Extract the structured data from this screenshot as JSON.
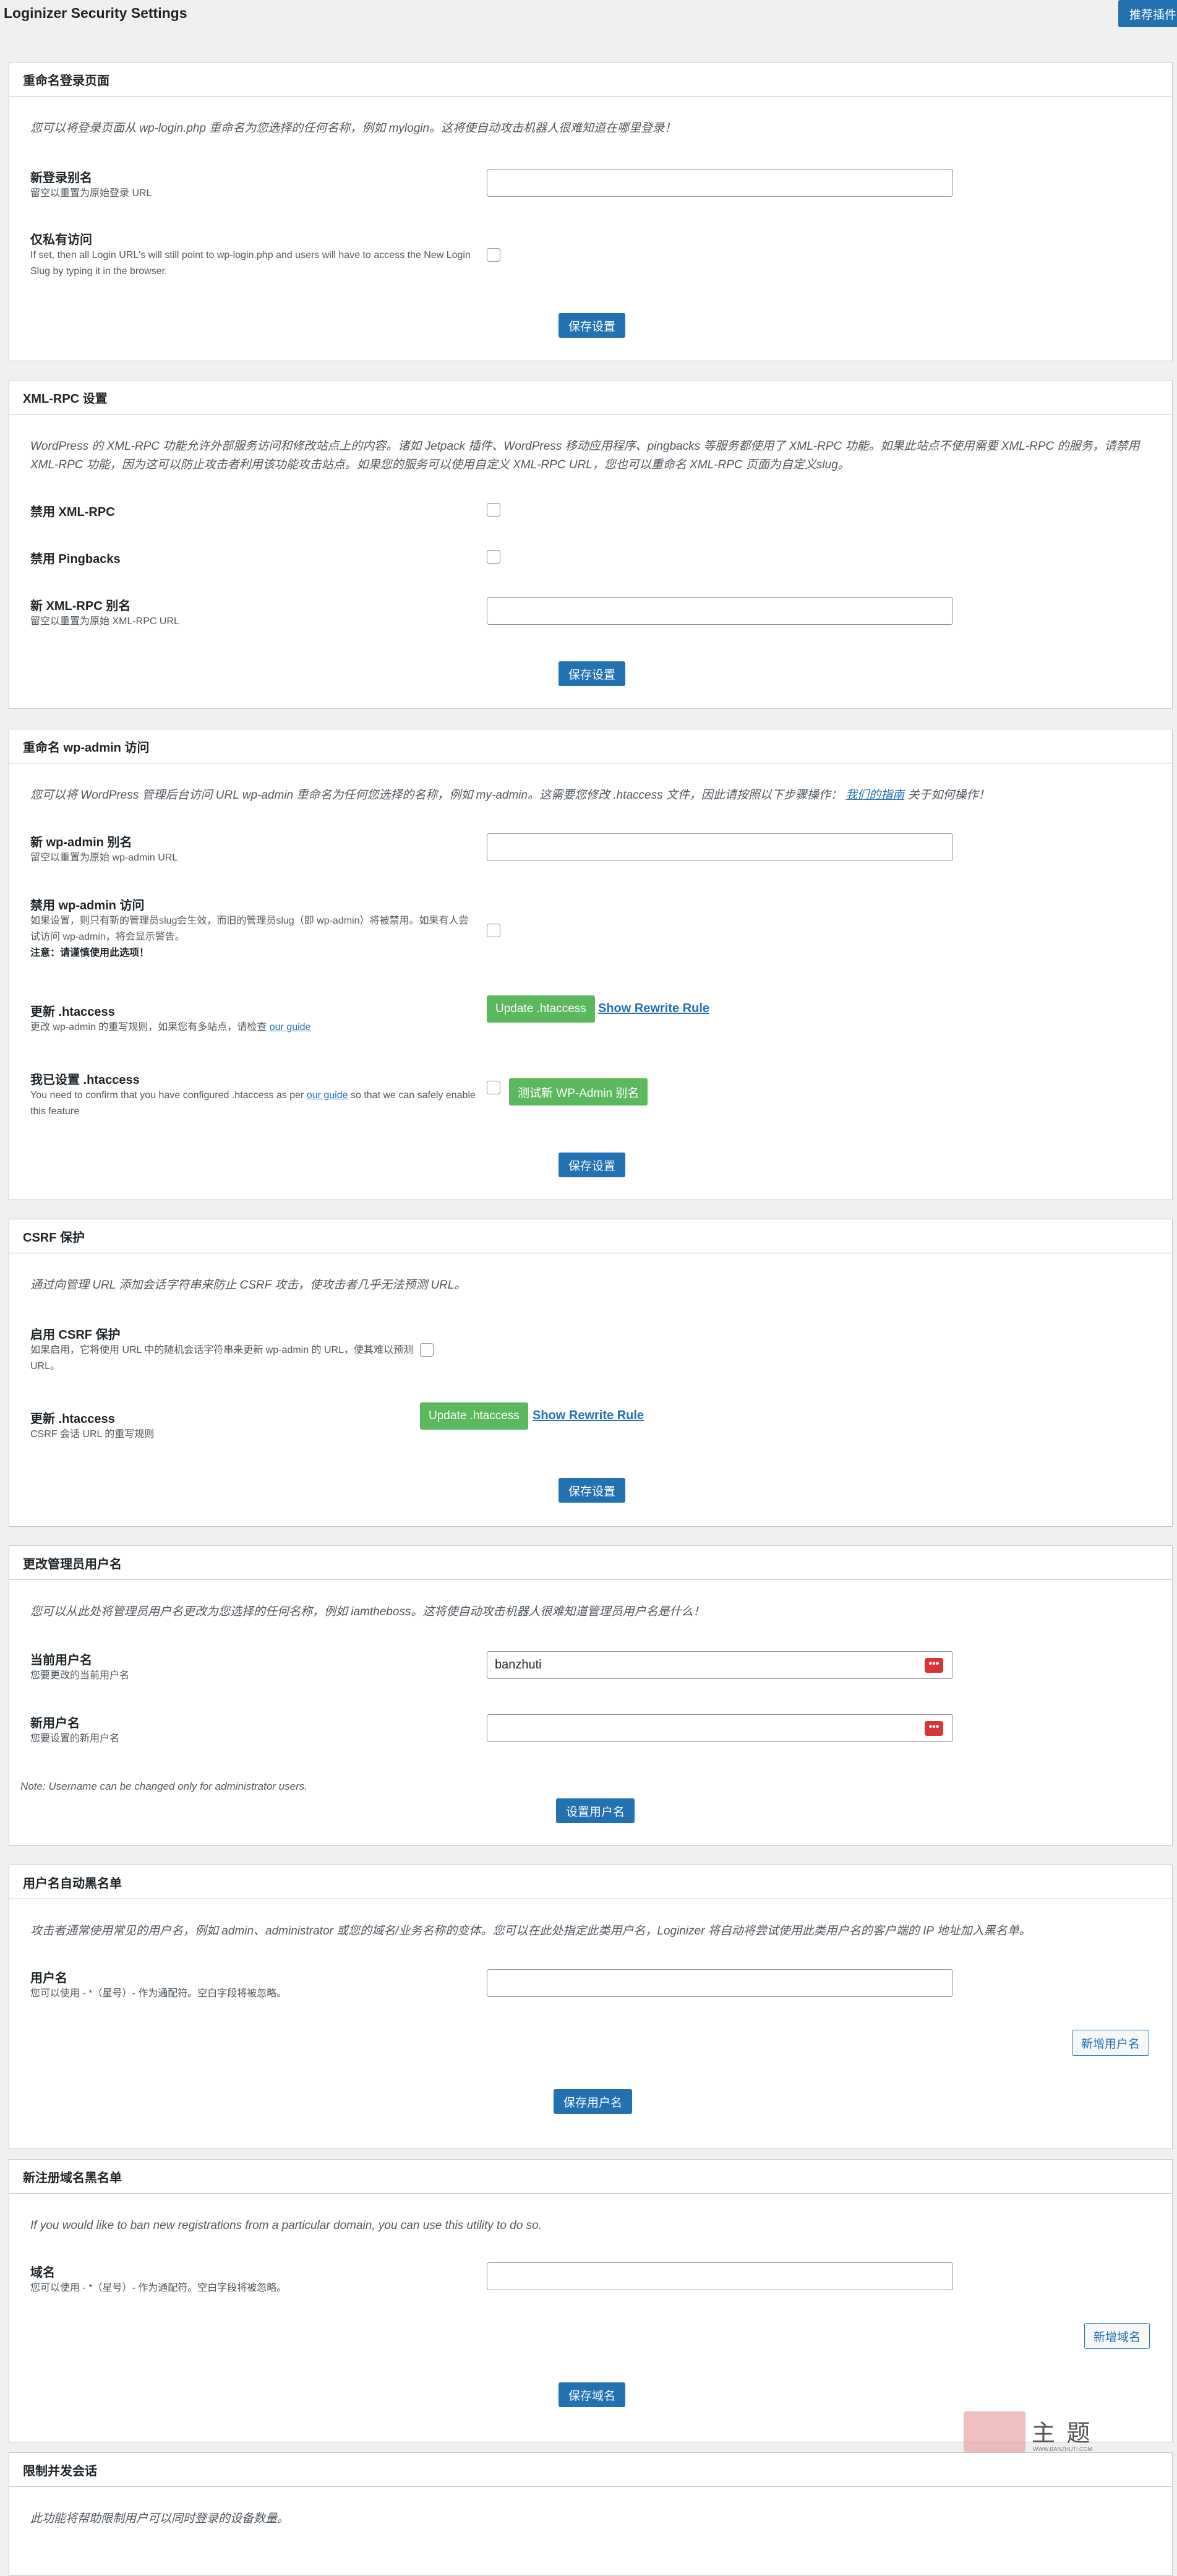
{
  "page": {
    "title": "Loginizer Security Settings",
    "top_button": "推荐",
    "top_button_full": "推荐插件"
  },
  "rename_login": {
    "title": "重命名登录页面",
    "desc": "您可以将登录页面从 wp-login.php 重命名为您选择的任何名称，例如 mylogin。这将使自动攻击机器人很难知道在哪里登录！",
    "slug_label": "新登录别名",
    "slug_sub": "留空以重置为原始登录 URL",
    "slug_value": "",
    "private_label": "仅私有访问",
    "private_sub": "If set, then all Login URL's will still point to wp-login.php and users will have to access the New Login Slug by typing it in the browser.",
    "save": "保存设置"
  },
  "xmlrpc": {
    "title": "XML-RPC 设置",
    "desc": "WordPress 的 XML-RPC 功能允许外部服务访问和修改站点上的内容。诸如 Jetpack 插件、WordPress 移动应用程序、pingbacks 等服务都使用了 XML-RPC 功能。如果此站点不使用需要 XML-RPC 的服务，请禁用 XML-RPC 功能，因为这可以防止攻击者利用该功能攻击站点。如果您的服务可以使用自定义 XML-RPC URL，您也可以重命名 XML-RPC 页面为自定义slug。",
    "disable_label": "禁用 XML-RPC",
    "pingbacks_label": "禁用 Pingbacks",
    "slug_label": "新 XML-RPC 别名",
    "slug_sub": "留空以重置为原始 XML-RPC URL",
    "slug_value": "",
    "save": "保存设置"
  },
  "wpadmin": {
    "title": "重命名 wp-admin 访问",
    "desc_pre": "您可以将 WordPress 管理后台访问 URL wp-admin 重命名为任何您选择的名称，例如 my-admin。这需要您修改 .htaccess 文件，因此请按照以下步骤操作：",
    "desc_link": "我们的指南",
    "desc_post": "关于如何操作！",
    "slug_label": "新 wp-admin 别名",
    "slug_sub": "留空以重置为原始 wp-admin URL",
    "slug_value": "",
    "disable_label": "禁用 wp-admin 访问",
    "disable_sub": "如果设置，则只有新的管理员slug会生效，而旧的管理员slug（即 wp-admin）将被禁用。如果有人尝试访问 wp-admin，将会显示警告。",
    "disable_note": "注意：请谨慎使用此选项！",
    "update_label": "更新 .htaccess",
    "update_sub_pre": "更改 wp-admin 的重写规则，如果您有多站点，请检查",
    "update_sub_link": "our guide",
    "update_btn": "Update .htaccess",
    "rewrite_link": "Show Rewrite Rule",
    "configured_label": "我已设置 .htaccess",
    "configured_sub_pre": "You need to confirm that you have configured .htaccess as per",
    "configured_sub_link": "our guide",
    "configured_sub_post": "so that we can safely enable this feature",
    "test_btn": "测试新 WP-Admin 别名",
    "save": "保存设置"
  },
  "csrf": {
    "title": "CSRF 保护",
    "desc": "通过向管理 URL 添加会话字符串来防止 CSRF 攻击，使攻击者几乎无法预测 URL。",
    "enable_label": "启用 CSRF 保护",
    "enable_sub": "如果启用，它将使用 URL 中的随机会话字符串来更新 wp-admin 的 URL，使其难以预测 URL。",
    "update_label": "更新 .htaccess",
    "update_sub": "CSRF 会话 URL 的重写规则",
    "update_btn": "Update .htaccess",
    "rewrite_link": "Show Rewrite Rule",
    "save": "保存设置"
  },
  "admin_username": {
    "title": "更改管理员用户名",
    "desc": "您可以从此处将管理员用户名更改为您选择的任何名称，例如 iamtheboss。这将使自动攻击机器人很难知道管理员用户名是什么！",
    "current_label": "当前用户名",
    "current_sub": "您要更改的当前用户名",
    "current_value": "banzhuti",
    "new_label": "新用户名",
    "new_sub": "您要设置的新用户名",
    "new_value": "",
    "badge": "•••",
    "note": "Note: Username can be changed only for administrator users.",
    "save": "设置用户名"
  },
  "username_blacklist": {
    "title": "用户名自动黑名单",
    "desc": "攻击者通常使用常见的用户名，例如 admin、administrator 或您的域名/业务名称的变体。您可以在此处指定此类用户名，Loginizer 将自动将尝试使用此类用户名的客户端的 IP 地址加入黑名单。",
    "field_label": "用户名",
    "field_sub": "您可以使用 - *（星号）- 作为通配符。空白字段将被忽略。",
    "field_value": "",
    "add_btn": "新增用户名",
    "save": "保存用户名"
  },
  "domain_blacklist": {
    "title": "新注册域名黑名单",
    "desc": "If you would like to ban new registrations from a particular domain, you can use this utility to do so.",
    "field_label": "域名",
    "field_sub": "您可以使用 - *（星号）- 作为通配符。空白字段将被忽略。",
    "field_value": "",
    "add_btn": "新增域名",
    "save": "保存域名"
  },
  "concurrent": {
    "title": "限制并发会话",
    "desc": "此功能将帮助限制用户可以同时登录的设备数量。"
  },
  "watermark": {
    "text": "主 题",
    "sub": "WWW.BANZHUTI.COM"
  }
}
